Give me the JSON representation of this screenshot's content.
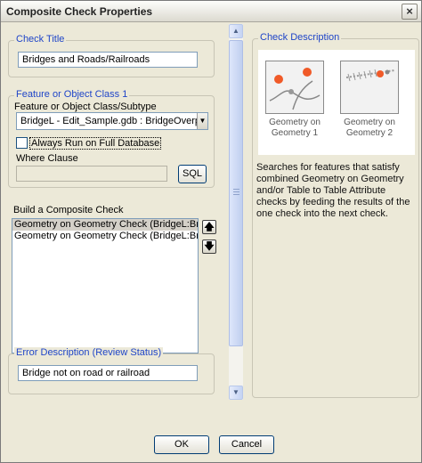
{
  "window": {
    "title": "Composite Check Properties",
    "close_glyph": "×"
  },
  "check_title": {
    "legend": "Check Title",
    "value": "Bridges and Roads/Railroads"
  },
  "feature_class": {
    "legend": "Feature or Object Class 1",
    "subtype_label": "Feature or Object Class/Subtype",
    "subtype_value": "BridgeL -  Edit_Sample.gdb : BridgeOverpas",
    "always_run_label": "Always Run on Full Database",
    "always_run_checked": false,
    "where_clause_label": "Where Clause",
    "where_clause_value": "",
    "sql_button": "SQL"
  },
  "composite": {
    "label": "Build a Composite Check",
    "items": [
      "Geometry on Geometry Check (BridgeL:BridgeOverp",
      "Geometry on Geometry Check (BridgeL:BridgeOverp"
    ],
    "selected_index": 0,
    "move_up_icon": "arrow-up-icon",
    "move_down_icon": "arrow-down-icon"
  },
  "error_description": {
    "legend": "Error Description (Review Status)",
    "value": "Bridge not on road or railroad"
  },
  "check_description": {
    "legend": "Check Description",
    "thumbnails": [
      {
        "caption_line1": "Geometry on",
        "caption_line2": "Geometry 1"
      },
      {
        "caption_line1": "Geometry on",
        "caption_line2": "Geometry 2"
      }
    ],
    "text": "Searches for features that satisfy combined Geometry on Geometry and/or Table to Table Attribute checks by feeding the results of the one check into the next check."
  },
  "buttons": {
    "ok": "OK",
    "cancel": "Cancel"
  },
  "colors": {
    "legend_blue": "#1f45c8",
    "dot_red": "#f05a28",
    "dialog_bg": "#ece9d8"
  }
}
